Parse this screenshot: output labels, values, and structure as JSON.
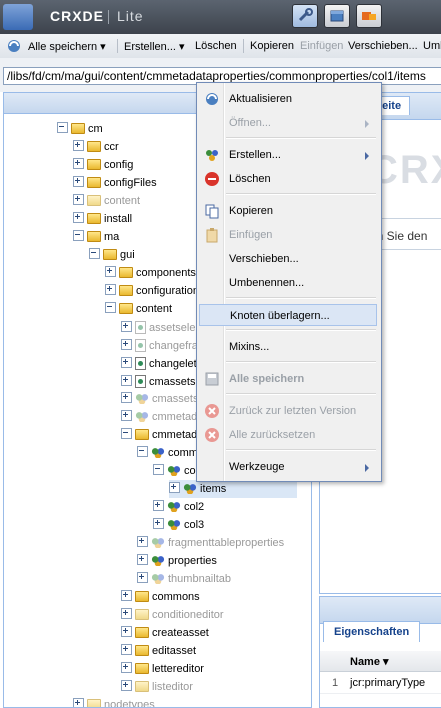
{
  "header": {
    "app_name": "CRXDE",
    "app_suffix": "Lite"
  },
  "toolbar": {
    "save_all": "Alle speichern ▾",
    "create": "Erstellen... ▾",
    "delete": "Löschen",
    "copy": "Kopieren",
    "paste": "Einfügen",
    "move": "Verschieben...",
    "more": "Umb"
  },
  "path": {
    "value": "/libs/fd/cm/ma/gui/content/cmmetadataproperties/commonproperties/col1/items"
  },
  "tree": [
    {
      "label": "cm"
    },
    {
      "label": "ccr"
    },
    {
      "label": "config"
    },
    {
      "label": "configFiles"
    },
    {
      "label": "content"
    },
    {
      "label": "install"
    },
    {
      "label": "ma"
    },
    {
      "label": "gui"
    },
    {
      "label": "components"
    },
    {
      "label": "configuration"
    },
    {
      "label": "content"
    },
    {
      "label": "assetsele"
    },
    {
      "label": "changefra"
    },
    {
      "label": "changelet"
    },
    {
      "label": "cmassets"
    },
    {
      "label": "cmassets"
    },
    {
      "label": "cmmetada"
    },
    {
      "label": "cmmetada"
    },
    {
      "label": "commo"
    },
    {
      "label": "col"
    },
    {
      "label": "items"
    },
    {
      "label": "col2"
    },
    {
      "label": "col3"
    },
    {
      "label": "fragmenttableproperties"
    },
    {
      "label": "properties"
    },
    {
      "label": "thumbnailtab"
    },
    {
      "label": "commons"
    },
    {
      "label": "conditioneditor"
    },
    {
      "label": "createasset"
    },
    {
      "label": "editasset"
    },
    {
      "label": "lettereditor"
    },
    {
      "label": "listeditor"
    },
    {
      "label": "nodetypes"
    }
  ],
  "context_menu": [
    {
      "label": "Aktualisieren"
    },
    {
      "label": "Öffnen..."
    },
    {
      "label": "Erstellen..."
    },
    {
      "label": "Löschen"
    },
    {
      "label": "Kopieren"
    },
    {
      "label": "Einfügen"
    },
    {
      "label": "Verschieben..."
    },
    {
      "label": "Umbenennen..."
    },
    {
      "label": "Knoten überlagern..."
    },
    {
      "label": "Mixins..."
    },
    {
      "label": "Alle speichern"
    },
    {
      "label": "Zurück zur letzten Version"
    },
    {
      "label": "Alle zurücksetzen"
    },
    {
      "label": "Werkzeuge"
    }
  ],
  "right_panel": {
    "tab_label": "seite",
    "logo_text": "CRX",
    "welcome_text": "en Sie den"
  },
  "properties_panel": {
    "tab_label": "Eigenschaften",
    "column_name": "Name ▾",
    "rows": [
      {
        "index": "1",
        "name": "jcr:primaryType"
      }
    ]
  }
}
